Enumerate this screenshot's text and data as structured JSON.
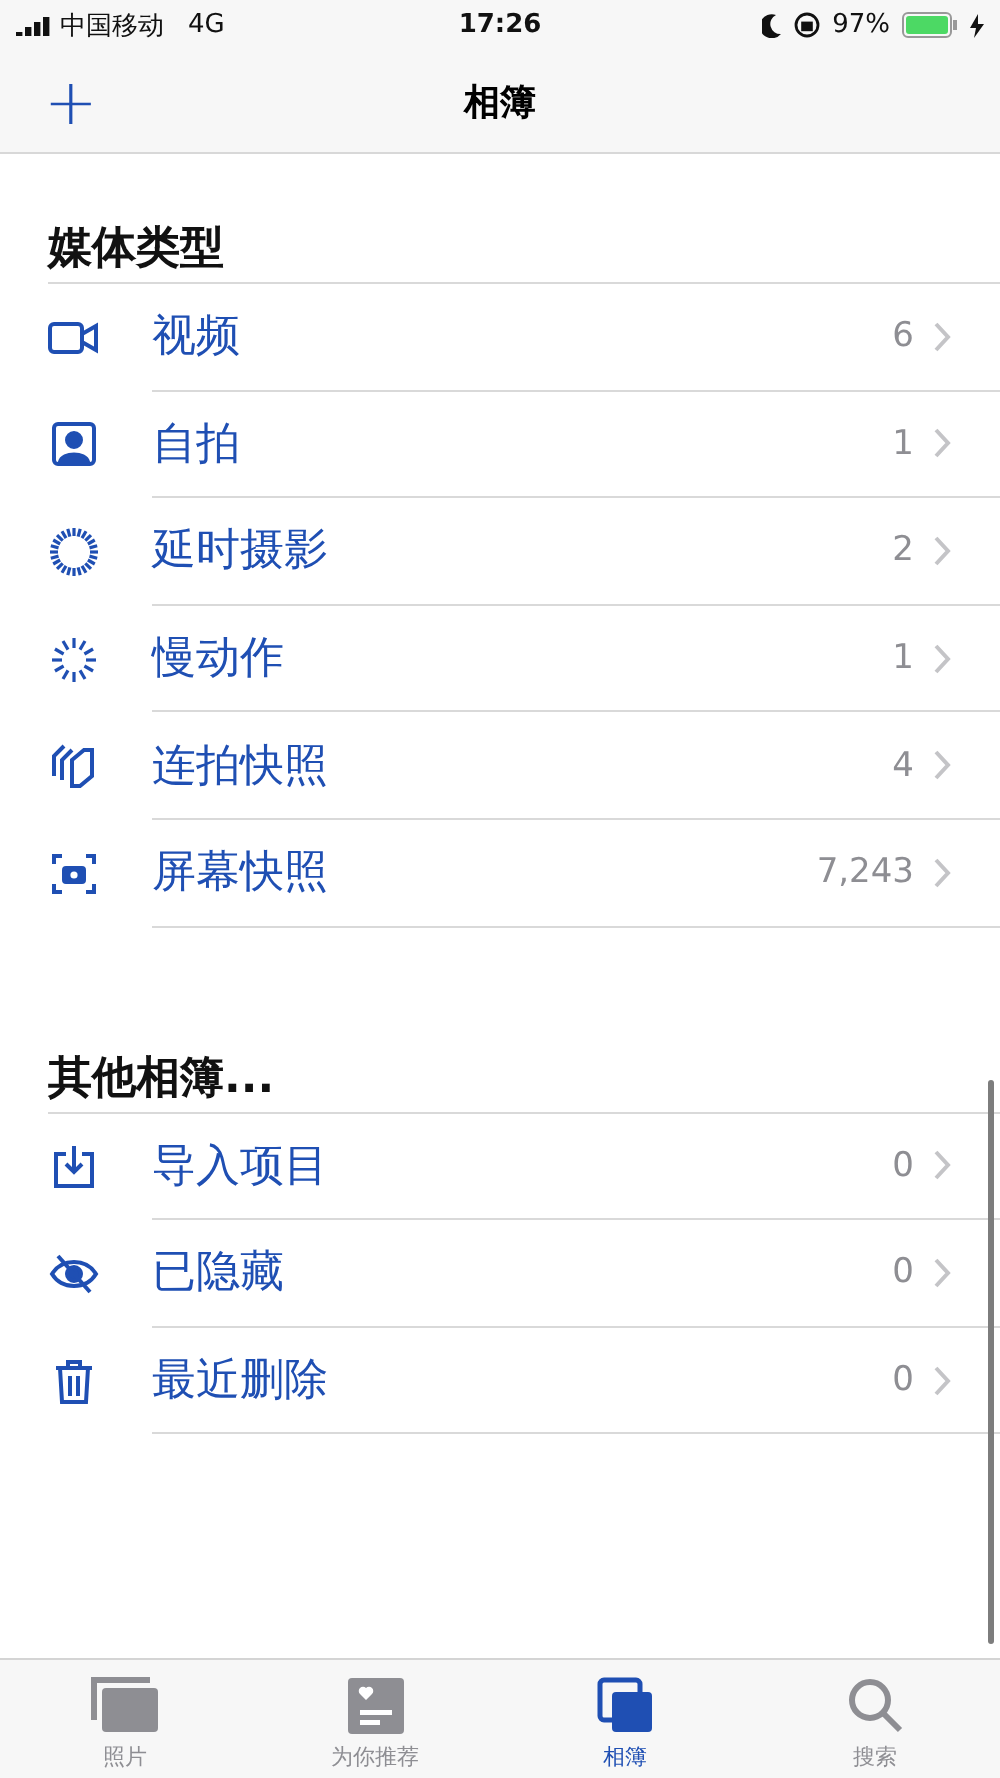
{
  "status_bar": {
    "carrier": "中国移动",
    "network": "4G",
    "time": "17:26",
    "battery": "97%"
  },
  "nav": {
    "add": "+",
    "title": "相簿"
  },
  "sections": [
    {
      "title": "媒体类型",
      "items": [
        {
          "kind": "video",
          "label": "视频",
          "count": "6"
        },
        {
          "kind": "selfie",
          "label": "自拍",
          "count": "1"
        },
        {
          "kind": "timelapse",
          "label": "延时摄影",
          "count": "2"
        },
        {
          "kind": "slomo",
          "label": "慢动作",
          "count": "1"
        },
        {
          "kind": "burst",
          "label": "连拍快照",
          "count": "4"
        },
        {
          "kind": "screenshot",
          "label": "屏幕快照",
          "count": "7,243"
        }
      ]
    },
    {
      "title": "其他相簿...",
      "items": [
        {
          "kind": "import",
          "label": "导入项目",
          "count": "0"
        },
        {
          "kind": "hidden",
          "label": "已隐藏",
          "count": "0"
        },
        {
          "kind": "trash",
          "label": "最近删除",
          "count": "0"
        }
      ]
    }
  ],
  "tabs": [
    {
      "kind": "photos",
      "label": "照片",
      "selected": false
    },
    {
      "kind": "foryou",
      "label": "为你推荐",
      "selected": false
    },
    {
      "kind": "albums",
      "label": "相簿",
      "selected": true
    },
    {
      "kind": "search",
      "label": "搜索",
      "selected": false
    }
  ]
}
